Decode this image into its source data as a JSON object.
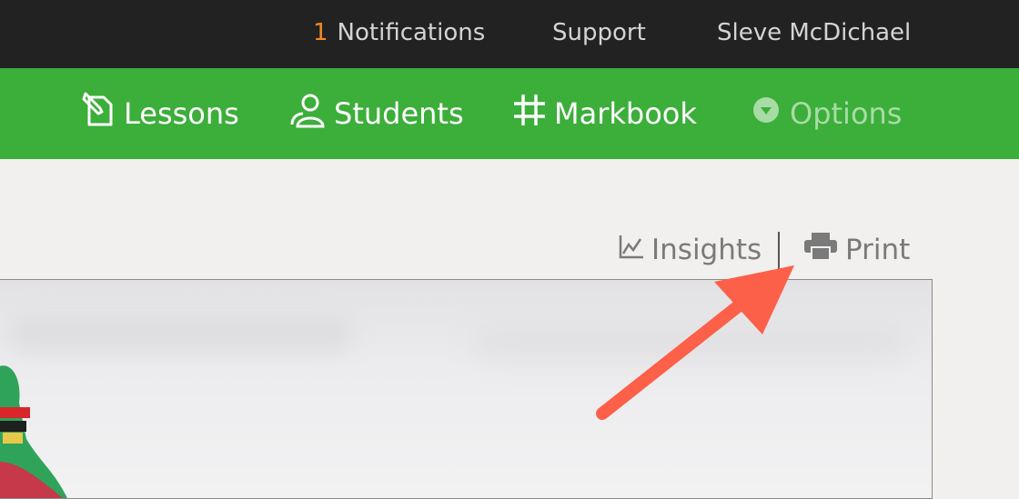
{
  "topbar": {
    "notifications_count": "1",
    "notifications_label": "Notifications",
    "support_label": "Support",
    "user_name": "Sleve McDichael"
  },
  "navbar": {
    "lessons_label": "Lessons",
    "students_label": "Students",
    "markbook_label": "Markbook",
    "options_label": "Options"
  },
  "toolbar": {
    "insights_label": "Insights",
    "print_label": "Print"
  },
  "colors": {
    "topbar_bg": "#222222",
    "navbar_bg": "#3cae3a",
    "notification_accent": "#f08a24",
    "annotation_arrow": "#fd6049"
  },
  "icons": {
    "lessons": "pencil-page-icon",
    "students": "users-icon",
    "markbook": "grid-hash-icon",
    "options": "chevron-down-circle-icon",
    "insights": "line-chart-icon",
    "print": "printer-icon"
  }
}
